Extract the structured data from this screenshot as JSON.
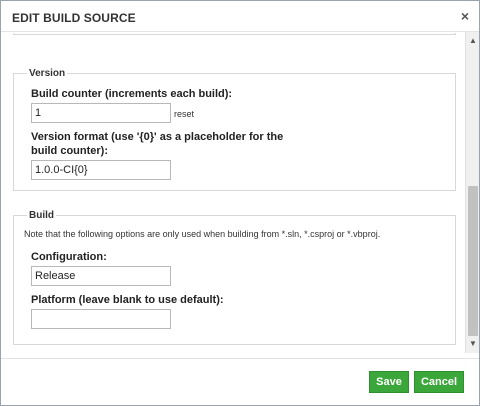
{
  "dialog": {
    "title": "EDIT BUILD SOURCE",
    "close_glyph": "×"
  },
  "version": {
    "legend": "Version",
    "build_counter_label": "Build counter (increments each build):",
    "build_counter_value": "1",
    "reset_label": "reset",
    "version_format_label_line1": "Version format (use '{0}' as a placeholder for the",
    "version_format_label_line2": "build counter):",
    "version_format_value": "1.0.0-CI{0}"
  },
  "build": {
    "legend": "Build",
    "note": "Note that the following options are only used when building from *.sln, *.csproj or *.vbproj.",
    "configuration_label": "Configuration:",
    "configuration_value": "Release",
    "platform_label": "Platform (leave blank to use default):",
    "platform_value": ""
  },
  "footer": {
    "save_label": "Save",
    "cancel_label": "Cancel"
  },
  "icons": {
    "scroll_up": "▲",
    "scroll_down": "▼"
  },
  "colors": {
    "primary_button": "#3ba73a"
  }
}
